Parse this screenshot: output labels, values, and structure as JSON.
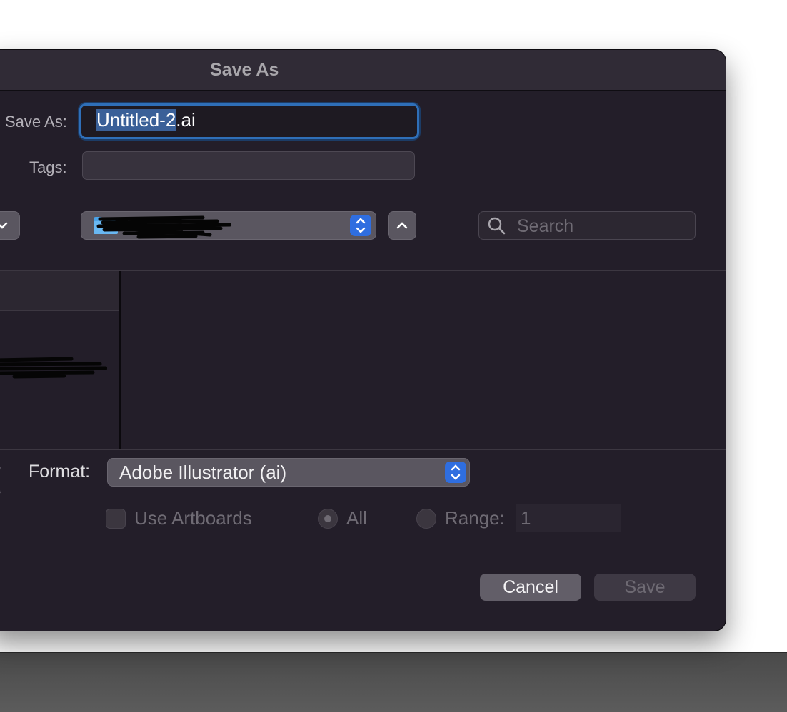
{
  "dialog": {
    "title": "Save As",
    "save_as_label": "Save As:",
    "filename_selected": "Untitled-2",
    "filename_ext": ".ai",
    "tags_label": "Tags:",
    "tags_value": "",
    "search_placeholder": "Search",
    "format_label": "Format:",
    "format_value": "Adobe Illustrator (ai)",
    "use_artboards_label": "Use Artboards",
    "use_artboards_checked": false,
    "radio_all_label": "All",
    "radio_range_label": "Range:",
    "range_value": "1",
    "cancel_label": "Cancel",
    "save_label": "Save",
    "icons": {
      "search": "search-icon",
      "folder": "folder-icon",
      "chevron_up": "chevron-up-icon",
      "chevron_down": "chevron-down-icon",
      "stepper": "up-down-stepper-icon"
    },
    "colors": {
      "accent": "#2f6ee0",
      "focus_ring": "#2f6fb8",
      "background": "#231e29"
    }
  }
}
